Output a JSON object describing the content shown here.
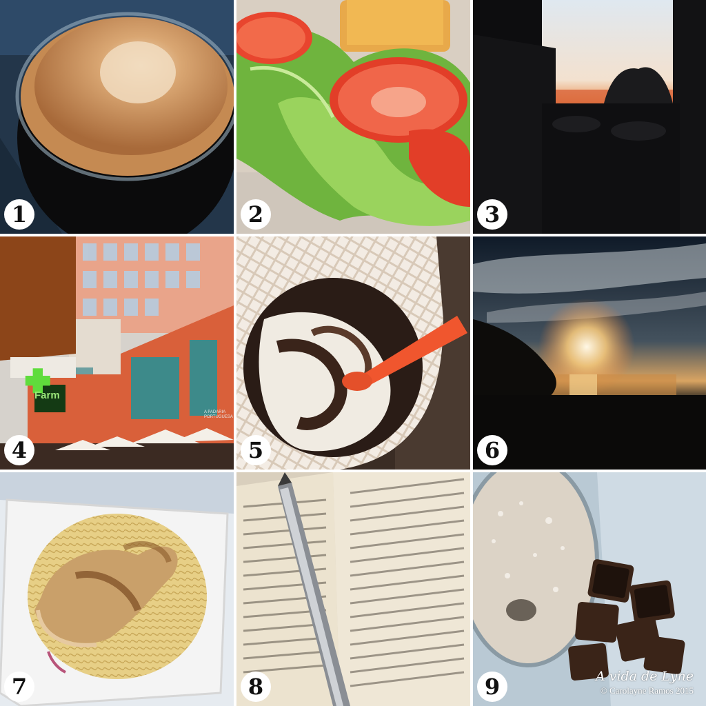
{
  "tiles": [
    {
      "number": "1",
      "subject": "coffee"
    },
    {
      "number": "2",
      "subject": "sandwich"
    },
    {
      "number": "3",
      "subject": "sunset-silhouette"
    },
    {
      "number": "4",
      "subject": "building"
    },
    {
      "number": "5",
      "subject": "ice-cream"
    },
    {
      "number": "6",
      "subject": "sunset-lake"
    },
    {
      "number": "7",
      "subject": "pasta-chicken"
    },
    {
      "number": "8",
      "subject": "book-pen"
    },
    {
      "number": "9",
      "subject": "milkshake-biscuits"
    }
  ],
  "signature": {
    "script": "A vida de Lyne",
    "copyright": "© Carolayne Ramos 2015"
  },
  "signs": {
    "pharmacy": "Farm",
    "shop_line1": "A PADARIA",
    "shop_line2": "PORTUGUESA"
  },
  "colors": {
    "coffee_crema": "#c58a52",
    "tomato": "#e8452e",
    "lettuce": "#7fc24a",
    "sunset_orange": "#e8823a",
    "building_orange": "#d9603a",
    "spoon_orange": "#f0562e",
    "plate_white": "#f4f4f4",
    "page_cream": "#ece3cf",
    "milkshake": "#dcd3c6"
  }
}
